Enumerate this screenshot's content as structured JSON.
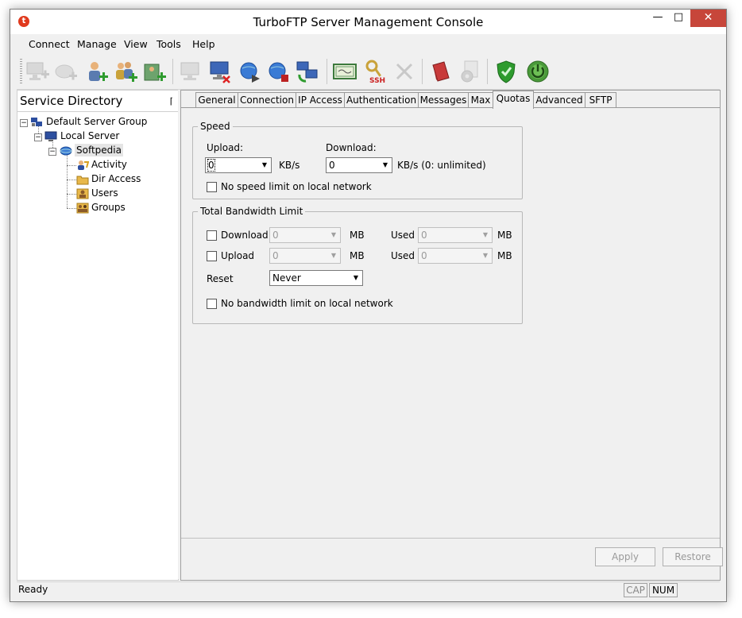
{
  "window": {
    "title": "TurboFTP Server Management Console"
  },
  "menu": [
    "Connect",
    "Manage",
    "View",
    "Tools",
    "Help"
  ],
  "toolbar_icons": [
    "computer-add-icon",
    "computer-disabled-icon",
    "user-add-icon",
    "group-add-icon",
    "folder-add-icon",
    "computer-disabled-icon",
    "computer-remove-icon",
    "globe-forward-icon",
    "globe-stop-icon",
    "network-refresh-icon",
    "certificate-icon",
    "ssh-keys-icon",
    "delete-icon",
    "book-icon",
    "settings-icon",
    "shield-icon",
    "power-icon"
  ],
  "left_pane": {
    "title": "Service Directory",
    "tree": [
      {
        "label": "Default Server Group",
        "icon": "server-group-icon",
        "level": 0
      },
      {
        "label": "Local Server",
        "icon": "monitor-icon",
        "level": 1
      },
      {
        "label": "Softpedia",
        "icon": "globe-icon",
        "level": 2
      },
      {
        "label": "Activity",
        "icon": "activity-icon",
        "level": 3
      },
      {
        "label": "Dir Access",
        "icon": "folder-icon",
        "level": 3
      },
      {
        "label": "Users",
        "icon": "user-icon",
        "level": 3
      },
      {
        "label": "Groups",
        "icon": "group-icon",
        "level": 3
      }
    ]
  },
  "tabs": [
    "General",
    "Connection",
    "IP Access",
    "Authentication",
    "Messages",
    "Max",
    "Quotas",
    "Advanced",
    "SFTP"
  ],
  "active_tab": "Quotas",
  "speed": {
    "title": "Speed",
    "upload_label": "Upload:",
    "upload_value": "0",
    "download_label": "Download:",
    "download_value": "0",
    "unit_upload": "KB/s",
    "unit_download": "KB/s  (0: unlimited)",
    "no_limit_label": "No speed limit on local network"
  },
  "bandwidth": {
    "title": "Total Bandwidth Limit",
    "download_label": "Download",
    "download_value": "0",
    "upload_label": "Upload",
    "upload_value": "0",
    "unit": "MB",
    "used_label": "Used",
    "used_download": "0",
    "used_upload": "0",
    "reset_label": "Reset",
    "reset_value": "Never",
    "no_limit_label": "No bandwidth limit on local network"
  },
  "buttons": {
    "apply": "Apply",
    "restore": "Restore"
  },
  "status": {
    "text": "Ready",
    "cap": "CAP",
    "num": "NUM"
  },
  "colors": {
    "close_button": "#c7463a",
    "window_bg": "#f0f0f0"
  }
}
